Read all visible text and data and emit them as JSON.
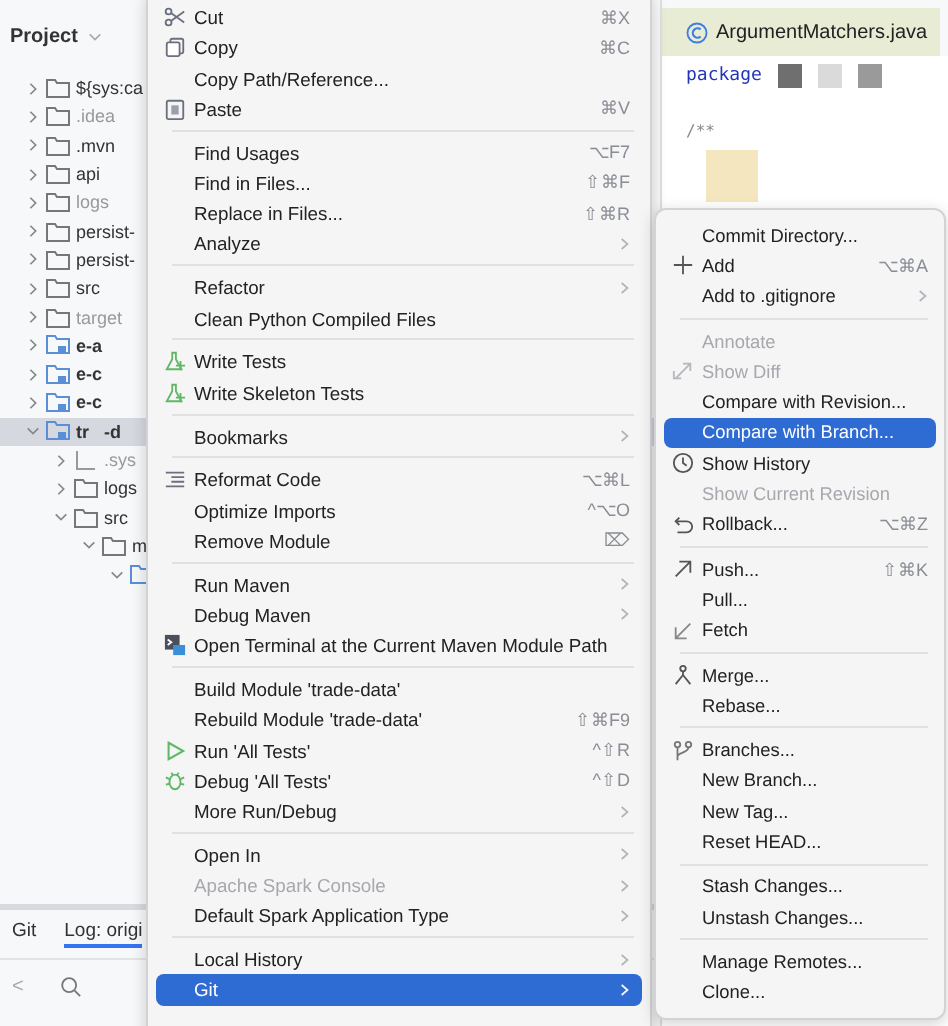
{
  "project_panel": {
    "title": "Project",
    "tree": [
      {
        "label": "${sys:ca",
        "kind": "folder",
        "dimmed": false,
        "expanded": false,
        "selected": false
      },
      {
        "label": ".idea",
        "kind": "folder",
        "dimmed": true,
        "expanded": false,
        "selected": false
      },
      {
        "label": ".mvn",
        "kind": "folder",
        "dimmed": false,
        "expanded": false,
        "selected": false
      },
      {
        "label": "api",
        "kind": "folder",
        "dimmed": false,
        "expanded": false,
        "selected": false
      },
      {
        "label": "logs",
        "kind": "folder",
        "dimmed": true,
        "expanded": false,
        "selected": false
      },
      {
        "label": "persist-",
        "kind": "folder",
        "dimmed": false,
        "expanded": false,
        "selected": false
      },
      {
        "label": "persist-",
        "kind": "folder",
        "dimmed": false,
        "expanded": false,
        "selected": false
      },
      {
        "label": "src",
        "kind": "folder",
        "dimmed": false,
        "expanded": false,
        "selected": false
      },
      {
        "label": "target",
        "kind": "folder",
        "dimmed": true,
        "expanded": false,
        "selected": false
      },
      {
        "label": "e-a",
        "kind": "module",
        "dimmed": false,
        "expanded": false,
        "selected": false
      },
      {
        "label": "e-c",
        "kind": "module",
        "dimmed": false,
        "expanded": false,
        "selected": false
      },
      {
        "label": "e-c",
        "kind": "module",
        "dimmed": false,
        "expanded": false,
        "selected": false
      },
      {
        "label": "tr   -d",
        "kind": "module",
        "dimmed": false,
        "expanded": true,
        "selected": true,
        "children": [
          {
            "label": ".sys",
            "kind": "plain",
            "dimmed": true,
            "expanded": false,
            "selected": false
          },
          {
            "label": "logs",
            "kind": "folder",
            "dimmed": false,
            "expanded": false,
            "selected": false
          },
          {
            "label": "src",
            "kind": "folder",
            "dimmed": false,
            "expanded": true,
            "selected": false,
            "children": [
              {
                "label": "m",
                "kind": "folder",
                "dimmed": false,
                "expanded": true,
                "selected": false,
                "children": [
                  {
                    "kind": "package",
                    "expanded": true,
                    "selected": false
                  }
                ]
              }
            ]
          }
        ]
      }
    ]
  },
  "git_panel": {
    "tabs": [
      {
        "label": "Git",
        "selected": false
      },
      {
        "label": "Log: origi",
        "selected": true
      }
    ],
    "back": "<"
  },
  "editor": {
    "tab": "ArgumentMatchers.java",
    "lines": [
      "package",
      "/**"
    ]
  },
  "menu": {
    "items": [
      {
        "kind": "item",
        "label": "Cut",
        "shortcut": "⌘X",
        "submenu": false,
        "disabled": false,
        "selected": false
      },
      {
        "kind": "item",
        "label": "Copy",
        "shortcut": "⌘C",
        "submenu": false,
        "disabled": false,
        "selected": false
      },
      {
        "kind": "item",
        "label": "Copy Path/Reference...",
        "submenu": false,
        "disabled": false,
        "selected": false
      },
      {
        "kind": "item",
        "label": "Paste",
        "shortcut": "⌘V",
        "submenu": false,
        "disabled": false,
        "selected": false
      },
      {
        "kind": "separator"
      },
      {
        "kind": "item",
        "label": "Find Usages",
        "shortcut": "⌥F7",
        "submenu": false,
        "disabled": false,
        "selected": false
      },
      {
        "kind": "item",
        "label": "Find in Files...",
        "shortcut": "⇧⌘F",
        "submenu": false,
        "disabled": false,
        "selected": false
      },
      {
        "kind": "item",
        "label": "Replace in Files...",
        "shortcut": "⇧⌘R",
        "submenu": false,
        "disabled": false,
        "selected": false
      },
      {
        "kind": "item",
        "label": "Analyze",
        "submenu": true,
        "disabled": false,
        "selected": false
      },
      {
        "kind": "separator"
      },
      {
        "kind": "item",
        "label": "Refactor",
        "submenu": true,
        "disabled": false,
        "selected": false
      },
      {
        "kind": "item",
        "label": "Clean Python Compiled Files",
        "submenu": false,
        "disabled": false,
        "selected": false
      },
      {
        "kind": "separator"
      },
      {
        "kind": "item",
        "label": "Write Tests",
        "submenu": false,
        "disabled": false,
        "selected": false
      },
      {
        "kind": "item",
        "label": "Write Skeleton Tests",
        "submenu": false,
        "disabled": false,
        "selected": false
      },
      {
        "kind": "separator"
      },
      {
        "kind": "item",
        "label": "Bookmarks",
        "submenu": true,
        "disabled": false,
        "selected": false
      },
      {
        "kind": "separator"
      },
      {
        "kind": "item",
        "label": "Reformat Code",
        "shortcut": "⌥⌘L",
        "submenu": false,
        "disabled": false,
        "selected": false
      },
      {
        "kind": "item",
        "label": "Optimize Imports",
        "shortcut": "^⌥O",
        "submenu": false,
        "disabled": false,
        "selected": false
      },
      {
        "kind": "item",
        "label": "Remove Module",
        "shortcut": "⌦",
        "submenu": false,
        "disabled": false,
        "selected": false
      },
      {
        "kind": "separator"
      },
      {
        "kind": "item",
        "label": "Run Maven",
        "submenu": true,
        "disabled": false,
        "selected": false
      },
      {
        "kind": "item",
        "label": "Debug Maven",
        "submenu": true,
        "disabled": false,
        "selected": false
      },
      {
        "kind": "item",
        "label": "Open Terminal at the Current Maven Module Path",
        "submenu": false,
        "disabled": false,
        "selected": false
      },
      {
        "kind": "separator"
      },
      {
        "kind": "item",
        "label": "Build Module 'trade-data'",
        "submenu": false,
        "disabled": false,
        "selected": false
      },
      {
        "kind": "item",
        "label": "Rebuild Module 'trade-data'",
        "shortcut": "⇧⌘F9",
        "submenu": false,
        "disabled": false,
        "selected": false
      },
      {
        "kind": "item",
        "label": "Run 'All Tests'",
        "shortcut": "^⇧R",
        "submenu": false,
        "disabled": false,
        "selected": false
      },
      {
        "kind": "item",
        "label": "Debug 'All Tests'",
        "shortcut": "^⇧D",
        "submenu": false,
        "disabled": false,
        "selected": false
      },
      {
        "kind": "item",
        "label": "More Run/Debug",
        "submenu": true,
        "disabled": false,
        "selected": false
      },
      {
        "kind": "separator"
      },
      {
        "kind": "item",
        "label": "Open In",
        "submenu": true,
        "disabled": false,
        "selected": false
      },
      {
        "kind": "item",
        "label": "Apache Spark Console",
        "submenu": true,
        "disabled": true,
        "selected": false
      },
      {
        "kind": "item",
        "label": "Default Spark Application Type",
        "submenu": true,
        "disabled": false,
        "selected": false
      },
      {
        "kind": "separator"
      },
      {
        "kind": "item",
        "label": "Local History",
        "submenu": true,
        "disabled": false,
        "selected": false
      },
      {
        "kind": "item",
        "label": "Git",
        "submenu": true,
        "disabled": false,
        "selected": true
      }
    ]
  },
  "git_submenu": {
    "items": [
      {
        "kind": "item",
        "label": "Commit Directory...",
        "submenu": false,
        "disabled": false,
        "selected": false
      },
      {
        "kind": "item",
        "label": "Add",
        "shortcut": "⌥⌘A",
        "submenu": false,
        "disabled": false,
        "selected": false
      },
      {
        "kind": "item",
        "label": "Add to .gitignore",
        "submenu": true,
        "disabled": false,
        "selected": false
      },
      {
        "kind": "separator"
      },
      {
        "kind": "item",
        "label": "Annotate",
        "submenu": false,
        "disabled": true,
        "selected": false
      },
      {
        "kind": "item",
        "label": "Show Diff",
        "submenu": false,
        "disabled": true,
        "selected": false
      },
      {
        "kind": "item",
        "label": "Compare with Revision...",
        "submenu": false,
        "disabled": false,
        "selected": false
      },
      {
        "kind": "item",
        "label": "Compare with Branch...",
        "submenu": false,
        "disabled": false,
        "selected": true
      },
      {
        "kind": "item",
        "label": "Show History",
        "submenu": false,
        "disabled": false,
        "selected": false
      },
      {
        "kind": "item",
        "label": "Show Current Revision",
        "submenu": false,
        "disabled": true,
        "selected": false
      },
      {
        "kind": "item",
        "label": "Rollback...",
        "shortcut": "⌥⌘Z",
        "submenu": false,
        "disabled": false,
        "selected": false
      },
      {
        "kind": "separator"
      },
      {
        "kind": "item",
        "label": "Push...",
        "shortcut": "⇧⌘K",
        "submenu": false,
        "disabled": false,
        "selected": false
      },
      {
        "kind": "item",
        "label": "Pull...",
        "submenu": false,
        "disabled": false,
        "selected": false
      },
      {
        "kind": "item",
        "label": "Fetch",
        "submenu": false,
        "disabled": false,
        "selected": false
      },
      {
        "kind": "separator"
      },
      {
        "kind": "item",
        "label": "Merge...",
        "submenu": false,
        "disabled": false,
        "selected": false
      },
      {
        "kind": "item",
        "label": "Rebase...",
        "submenu": false,
        "disabled": false,
        "selected": false
      },
      {
        "kind": "separator"
      },
      {
        "kind": "item",
        "label": "Branches...",
        "submenu": false,
        "disabled": false,
        "selected": false
      },
      {
        "kind": "item",
        "label": "New Branch...",
        "submenu": false,
        "disabled": false,
        "selected": false
      },
      {
        "kind": "item",
        "label": "New Tag...",
        "submenu": false,
        "disabled": false,
        "selected": false
      },
      {
        "kind": "item",
        "label": "Reset HEAD...",
        "submenu": false,
        "disabled": false,
        "selected": false
      },
      {
        "kind": "separator"
      },
      {
        "kind": "item",
        "label": "Stash Changes...",
        "submenu": false,
        "disabled": false,
        "selected": false
      },
      {
        "kind": "item",
        "label": "Unstash Changes...",
        "submenu": false,
        "disabled": false,
        "selected": false
      },
      {
        "kind": "separator"
      },
      {
        "kind": "item",
        "label": "Manage Remotes...",
        "submenu": false,
        "disabled": false,
        "selected": false
      },
      {
        "kind": "item",
        "label": "Clone...",
        "submenu": false,
        "disabled": false,
        "selected": false
      }
    ]
  }
}
